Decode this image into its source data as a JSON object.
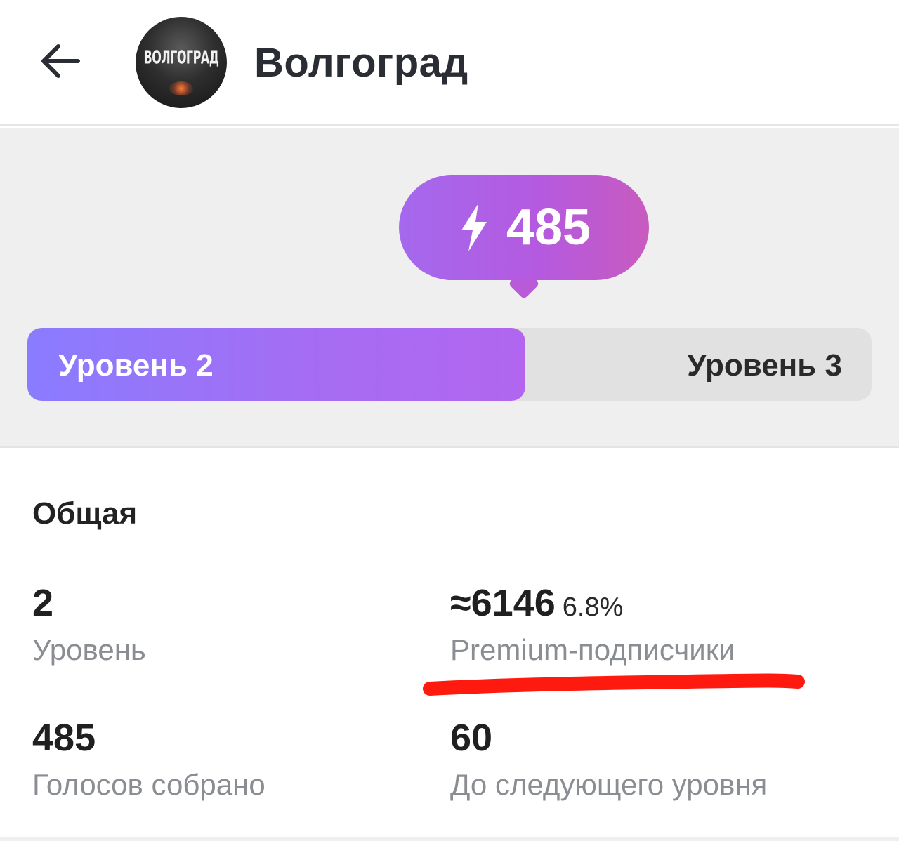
{
  "header": {
    "back_icon": "arrow-left-icon",
    "avatar_text": "ВОЛГОГРАД",
    "title": "Волгоград"
  },
  "boost": {
    "icon": "lightning-bolt-icon",
    "value": "485",
    "current_level_label": "Уровень 2",
    "next_level_label": "Уровень 3",
    "progress": 0.59,
    "colors": {
      "accent": "#a66cf2",
      "bubble": "#b45ae0",
      "track": "#e1e1e1"
    }
  },
  "stats": {
    "section_title": "Общая",
    "level": {
      "value": "2",
      "label": "Уровень"
    },
    "premium": {
      "value": "≈6146",
      "percent": "6.8%",
      "label": "Premium-подписчики"
    },
    "votes": {
      "value": "485",
      "label": "Голосов собрано"
    },
    "next": {
      "value": "60",
      "label": "До следующего уровня"
    }
  },
  "annotation": {
    "color": "#ff1a10"
  }
}
